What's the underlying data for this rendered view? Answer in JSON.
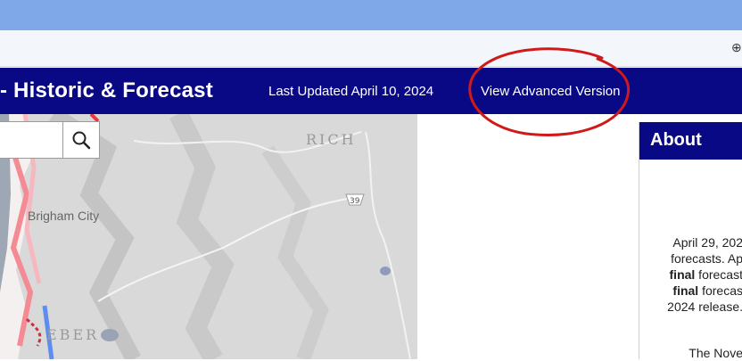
{
  "header": {
    "title": "- Historic & Forecast",
    "last_updated": "Last Updated April 10, 2024",
    "advanced_link": "View Advanced Version"
  },
  "map": {
    "labels": {
      "rich": "RICH",
      "brigham": "Brigham City",
      "weber": "EBER",
      "highway": "39"
    }
  },
  "about": {
    "title": "About",
    "line1": "April 29, 202",
    "line2": "forecasts. Ap",
    "line3_bold": "final",
    "line3_rest": " forecast",
    "line4_bold": "final",
    "line4_rest": " forecas",
    "line5": "2024 release.",
    "line6": "The Nove"
  },
  "colors": {
    "header_bg": "#090986",
    "browser_chrome": "#7ea8e8",
    "annotation": "#d01a1a"
  }
}
